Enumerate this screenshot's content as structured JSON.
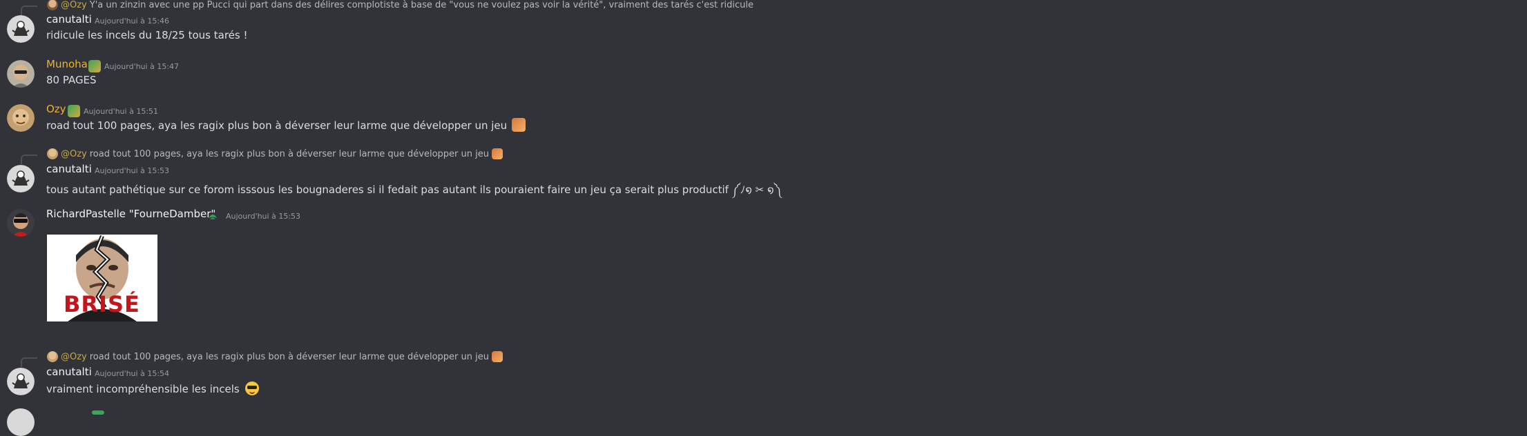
{
  "messages": [
    {
      "reply": {
        "mention": "@Ozy",
        "text": "Y'a un zinzin avec une pp Pucci qui part dans des délires complotiste à base de \"vous ne voulez pas voir la vérité\", vraiment des tarés c'est ridicule"
      },
      "username": "canutalti",
      "timestamp": "Aujourd'hui à 15:46",
      "text": "ridicule les incels du 18/25 tous tarés !"
    },
    {
      "username": "Munoha",
      "timestamp": "Aujourd'hui à 15:47",
      "text": "80 PAGES"
    },
    {
      "username": "Ozy",
      "timestamp": "Aujourd'hui à 15:51",
      "text": "road tout 100 pages, aya les ragix plus bon à déverser leur larme que développer un jeu"
    },
    {
      "reply": {
        "mention": "@Ozy",
        "text": "road tout 100 pages, aya les ragix plus bon à déverser leur larme que développer un jeu"
      },
      "username": "canutalti",
      "timestamp": "Aujourd'hui à 15:53",
      "text": "tous autant pathétique sur ce forom isssous les bougnaderes si il fedait pas autant ils pouraient faire un jeu ça serait plus productif  ༼ﾉ໑ ✂ ໑༽"
    },
    {
      "username": "RichardPastelle \"FourneDamber\"",
      "timestamp": "Aujourd'hui à 15:53",
      "image_caption": "BRISÉ"
    },
    {
      "reply": {
        "mention": "@Ozy",
        "text": "road tout 100 pages, aya les ragix plus bon à déverser leur larme que développer un jeu"
      },
      "username": "canutalti",
      "timestamp": "Aujourd'hui à 15:54",
      "text": "vraiment incompréhensible les incels"
    }
  ],
  "colors": {
    "background": "#313338",
    "username_default": "#f2f3f5",
    "username_gold": "#f0b232",
    "mention": "#c9a84c",
    "timestamp": "#949ba4"
  }
}
